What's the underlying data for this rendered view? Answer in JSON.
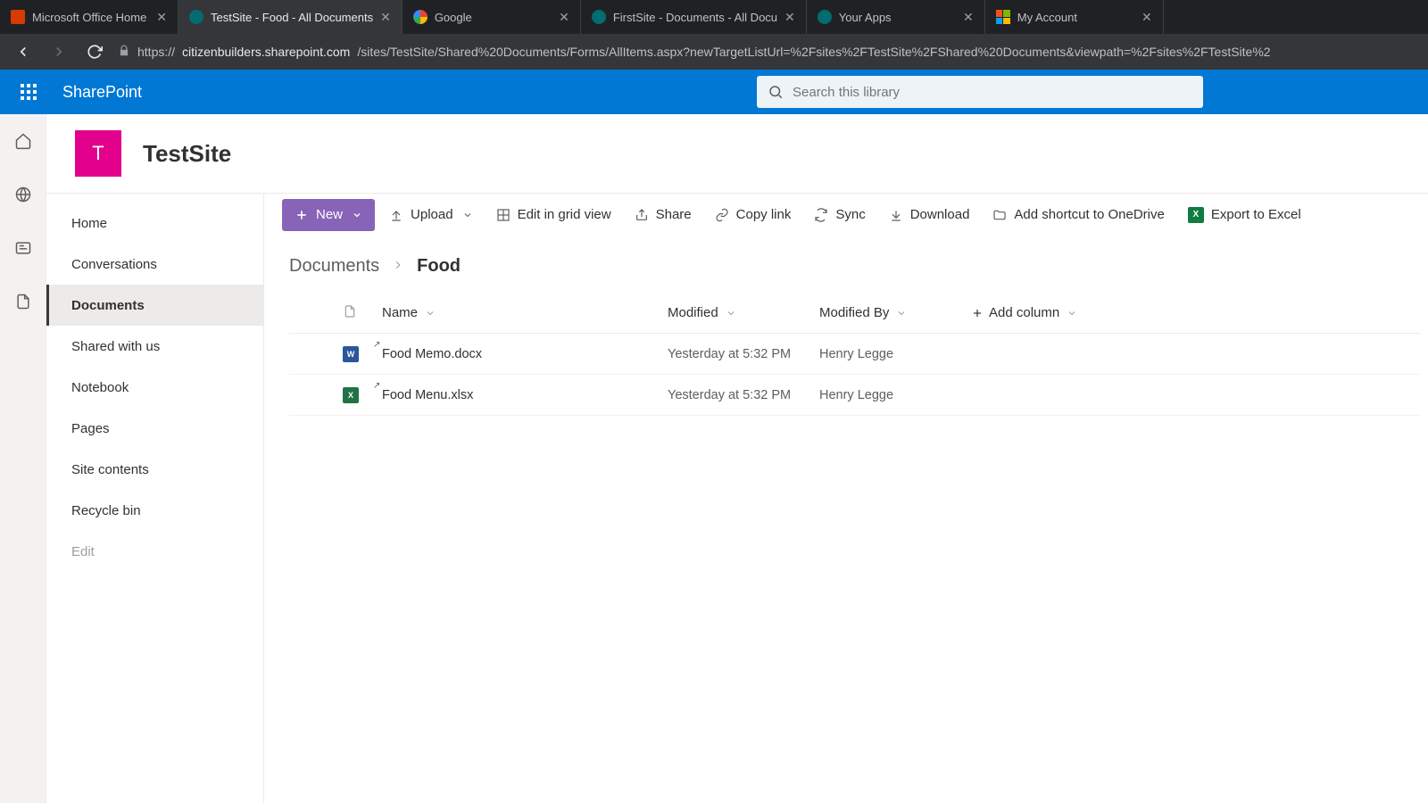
{
  "browser": {
    "tabs": [
      {
        "title": "Microsoft Office Home",
        "favicon": "office",
        "active": false
      },
      {
        "title": "TestSite - Food - All Documents",
        "favicon": "sharepoint",
        "active": true
      },
      {
        "title": "Google",
        "favicon": "google",
        "active": false
      },
      {
        "title": "FirstSite - Documents - All Docu",
        "favicon": "sharepoint",
        "active": false
      },
      {
        "title": "Your Apps",
        "favicon": "sharepoint",
        "active": false
      },
      {
        "title": "My Account",
        "favicon": "microsoft",
        "active": false
      }
    ],
    "url_host": "citizenbuilders.sharepoint.com",
    "url_path": "/sites/TestSite/Shared%20Documents/Forms/AllItems.aspx?newTargetListUrl=%2Fsites%2FTestSite%2FShared%20Documents&viewpath=%2Fsites%2FTestSite%2"
  },
  "suitebar": {
    "brand": "SharePoint",
    "search_placeholder": "Search this library"
  },
  "site": {
    "logo_letter": "T",
    "title": "TestSite"
  },
  "leftnav": {
    "items": [
      {
        "label": "Home"
      },
      {
        "label": "Conversations"
      },
      {
        "label": "Documents",
        "selected": true
      },
      {
        "label": "Shared with us"
      },
      {
        "label": "Notebook"
      },
      {
        "label": "Pages"
      },
      {
        "label": "Site contents"
      },
      {
        "label": "Recycle bin"
      }
    ],
    "edit_label": "Edit"
  },
  "commands": {
    "new": "New",
    "upload": "Upload",
    "edit_grid": "Edit in grid view",
    "share": "Share",
    "copy_link": "Copy link",
    "sync": "Sync",
    "download": "Download",
    "add_shortcut": "Add shortcut to OneDrive",
    "export_excel": "Export to Excel"
  },
  "breadcrumb": {
    "root": "Documents",
    "current": "Food"
  },
  "columns": {
    "name": "Name",
    "modified": "Modified",
    "modified_by": "Modified By",
    "add": "Add column"
  },
  "files": [
    {
      "type": "word",
      "name": "Food Memo.docx",
      "modified": "Yesterday at 5:32 PM",
      "modified_by": "Henry Legge"
    },
    {
      "type": "excel",
      "name": "Food Menu.xlsx",
      "modified": "Yesterday at 5:32 PM",
      "modified_by": "Henry Legge"
    }
  ]
}
